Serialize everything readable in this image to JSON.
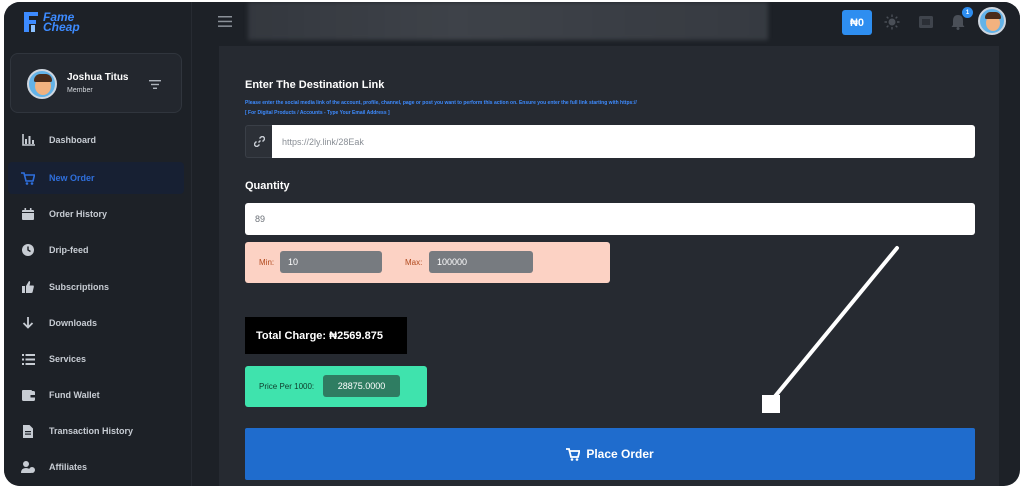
{
  "brand": {
    "line1": "Fame",
    "line2": "Cheap",
    "color": "#3d8bff"
  },
  "profile": {
    "name": "Joshua Titus",
    "role": "Member"
  },
  "nav": [
    {
      "label": "Dashboard",
      "icon": "chart-icon",
      "active": false
    },
    {
      "label": "New Order",
      "icon": "cart-icon",
      "active": true
    },
    {
      "label": "Order History",
      "icon": "calendar-icon",
      "active": false
    },
    {
      "label": "Drip-feed",
      "icon": "clock-icon",
      "active": false
    },
    {
      "label": "Subscriptions",
      "icon": "thumbs-up-icon",
      "active": false
    },
    {
      "label": "Downloads",
      "icon": "arrow-down-icon",
      "active": false
    },
    {
      "label": "Services",
      "icon": "list-icon",
      "active": false
    },
    {
      "label": "Fund Wallet",
      "icon": "wallet-icon",
      "active": false
    },
    {
      "label": "Transaction History",
      "icon": "file-icon",
      "active": false
    },
    {
      "label": "Affiliates",
      "icon": "users-icon",
      "active": false
    }
  ],
  "topbar": {
    "wallet_balance": "₦0",
    "notification_count": "1"
  },
  "form": {
    "destination_title": "Enter The Destination Link",
    "destination_help": "Please enter the social media link of the account, profile, channel, page or post you want to perform this action on. Ensure you enter the full link starting with https://",
    "destination_help2": "[ For Digital Products / Accounts - Type Your Email Address ]",
    "link_value": "https://2ly.link/28Eak",
    "quantity_title": "Quantity",
    "quantity_value": "89",
    "min_label": "Min:",
    "min_value": "10",
    "max_label": "Max:",
    "max_value": "100000",
    "total_charge": "Total Charge: ₦2569.875",
    "price_label": "Price Per 1000:",
    "price_value": "28875.0000",
    "submit_label": "Place Order"
  },
  "colors": {
    "accent": "#2e8ef0",
    "submit": "#1f6ccd",
    "minmax_bg": "#fcd2c4",
    "price_bg": "#3fe3ad"
  }
}
